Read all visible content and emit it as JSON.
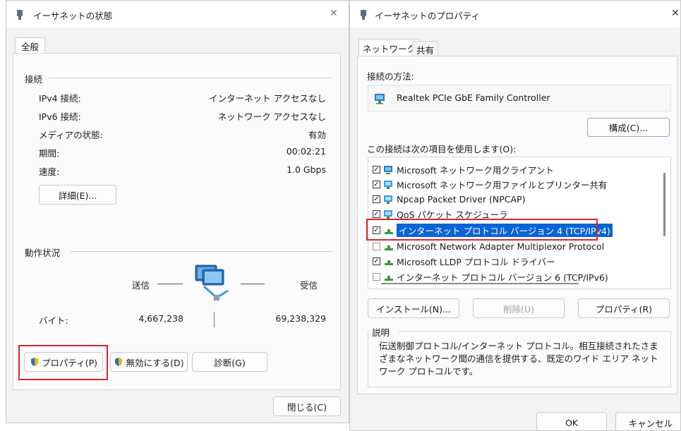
{
  "status_window": {
    "title": "イーサネットの状態",
    "close": "✕",
    "tab": "全般",
    "connection": {
      "heading": "接続",
      "rows": [
        {
          "label": "IPv4 接続:",
          "value": "インターネット アクセスなし"
        },
        {
          "label": "IPv6 接続:",
          "value": "ネットワーク アクセスなし"
        },
        {
          "label": "メディアの状態:",
          "value": "有効"
        },
        {
          "label": "期間:",
          "value": "00:02:21"
        },
        {
          "label": "速度:",
          "value": "1.0 Gbps"
        }
      ],
      "details_button": "詳細(E)..."
    },
    "activity": {
      "heading": "動作状況",
      "sent": "送信",
      "received": "受信",
      "bytes_label": "バイト:",
      "bytes_sent": "4,667,238",
      "bytes_received": "69,238,329"
    },
    "buttons": {
      "properties": "プロパティ(P)",
      "disable": "無効にする(D)",
      "diagnose": "診断(G)",
      "close": "閉じる(C)"
    }
  },
  "props_window": {
    "title": "イーサネットのプロパティ",
    "close": "✕",
    "tabs": [
      "ネットワーク",
      "共有"
    ],
    "connect_using_label": "接続の方法:",
    "adapter": "Realtek PCIe GbE Family Controller",
    "configure_button": "構成(C)...",
    "items_label": "この接続は次の項目を使用します(O):",
    "items": [
      {
        "label": "Microsoft ネットワーク用クライアント",
        "checked": true,
        "icon": "network-client-icon"
      },
      {
        "label": "Microsoft ネットワーク用ファイルとプリンター共有",
        "checked": true,
        "icon": "network-service-icon"
      },
      {
        "label": "Npcap Packet Driver (NPCAP)",
        "checked": true,
        "icon": "network-service-icon"
      },
      {
        "label": "QoS パケット スケジューラ",
        "checked": true,
        "icon": "network-service-icon"
      },
      {
        "label": "インターネット プロトコル バージョン 4 (TCP/IPv4)",
        "checked": true,
        "icon": "protocol-icon"
      },
      {
        "label": "Microsoft Network Adapter Multiplexor Protocol",
        "checked": false,
        "icon": "protocol-icon"
      },
      {
        "label": "Microsoft LLDP プロトコル ドライバー",
        "checked": true,
        "icon": "protocol-icon"
      },
      {
        "label": "インターネット プロトコル バージョン 6 (TCP/IPv6)",
        "checked": false,
        "icon": "protocol-icon"
      }
    ],
    "install_button": "インストール(N)...",
    "uninstall_button": "削除(U)",
    "properties_button": "プロパティ(R)",
    "description_heading": "説明",
    "description": "伝送制御プロトコル/インターネット プロトコル。相互接続されたさまざまなネットワーク間の通信を提供する、既定のワイド エリア ネットワーク プロトコルです。",
    "ok_button": "OK",
    "cancel_button": "キャンセル"
  },
  "colors": {
    "highlight": "#e0252b",
    "selection": "#0a64d6"
  }
}
